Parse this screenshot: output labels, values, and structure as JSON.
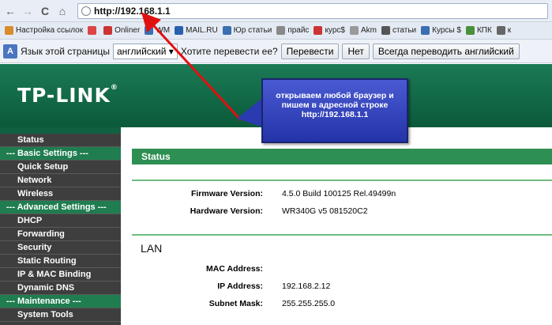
{
  "browser": {
    "url": "http://192.168.1.1",
    "nav": [
      "←",
      "→",
      "C",
      "⌂"
    ],
    "bookmarks": [
      {
        "label": "Настройка ссылок",
        "color": "#d98a2a"
      },
      {
        "label": "",
        "color": "#d44"
      },
      {
        "label": "Onliner",
        "color": "#c33"
      },
      {
        "label": "WM",
        "color": "#3a6fb0"
      },
      {
        "label": "MAIL.RU",
        "color": "#2a5fb0"
      },
      {
        "label": "Юр статьи",
        "color": "#3a6fb0"
      },
      {
        "label": "прайс",
        "color": "#888"
      },
      {
        "label": "курс$",
        "color": "#c33"
      },
      {
        "label": "Akm",
        "color": "#999"
      },
      {
        "label": "статьи",
        "color": "#555"
      },
      {
        "label": "Курсы $",
        "color": "#3a6fb0"
      },
      {
        "label": "КПК",
        "color": "#4a8f3a"
      },
      {
        "label": "к",
        "color": "#666"
      }
    ],
    "translate": {
      "prompt": "Язык этой страницы",
      "language": "английский",
      "question": "Хотите перевести ее?",
      "translate_btn": "Перевести",
      "no_btn": "Нет",
      "always_btn": "Всегда переводить английский"
    }
  },
  "router": {
    "logo": "TP-LINK",
    "logo_mark": "®",
    "sidebar": [
      {
        "label": "Status",
        "section": false
      },
      {
        "label": "--- Basic Settings ---",
        "section": true
      },
      {
        "label": "Quick Setup",
        "section": false
      },
      {
        "label": "Network",
        "section": false
      },
      {
        "label": "Wireless",
        "section": false
      },
      {
        "label": "--- Advanced Settings ---",
        "section": true
      },
      {
        "label": "DHCP",
        "section": false
      },
      {
        "label": "Forwarding",
        "section": false
      },
      {
        "label": "Security",
        "section": false
      },
      {
        "label": "Static Routing",
        "section": false
      },
      {
        "label": "IP & MAC Binding",
        "section": false
      },
      {
        "label": "Dynamic DNS",
        "section": false
      },
      {
        "label": "--- Maintenance ---",
        "section": true
      },
      {
        "label": "System Tools",
        "section": false
      }
    ],
    "status_title": "Status",
    "firmware_label": "Firmware Version:",
    "firmware_value": "4.5.0 Build 100125 Rel.49499n",
    "hardware_label": "Hardware Version:",
    "hardware_value": "WR340G v5 081520C2",
    "lan_title": "LAN",
    "mac_label": "MAC Address:",
    "mac_value": "",
    "ip_label": "IP Address:",
    "ip_value": "192.168.2.12",
    "mask_label": "Subnet Mask:",
    "mask_value": "255.255.255.0"
  },
  "annotation": {
    "line1": "открываем любой браузер и",
    "line2": "пишем в адресной строке",
    "line3": "http://192.168.1.1"
  },
  "colors": {
    "banner": "#0f6142",
    "section": "#1f7d50",
    "arrow": "#e01010"
  }
}
